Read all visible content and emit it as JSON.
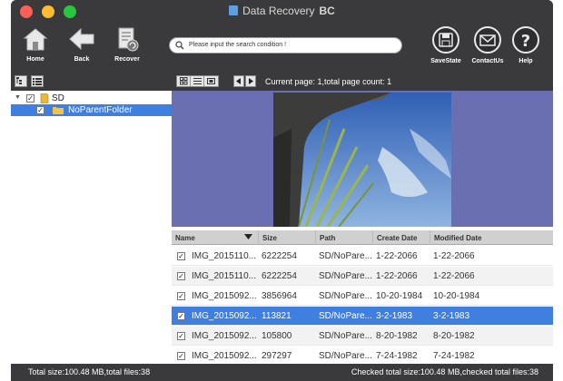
{
  "window": {
    "title": "Data Recovery",
    "title_suffix": "BC"
  },
  "toolbar": {
    "home_label": "Home",
    "back_label": "Back",
    "recover_label": "Recover",
    "savestate_label": "SaveState",
    "contactus_label": "ContactUs",
    "help_label": "Help",
    "search_placeholder": "Please input the search condition !"
  },
  "subbar": {
    "page_info": "Current page: 1,total page count: 1"
  },
  "tree": {
    "root_label": "SD",
    "child_label": "NoParentFolder"
  },
  "table": {
    "headers": {
      "name": "Name",
      "size": "Size",
      "path": "Path",
      "create": "Create Date",
      "modified": "Modified Date"
    },
    "rows": [
      {
        "name": "IMG_2015110...",
        "size": "6222254",
        "path": "SD/NoPare...",
        "create": "1-22-2066",
        "modified": "1-22-2066"
      },
      {
        "name": "IMG_2015110...",
        "size": "6222254",
        "path": "SD/NoPare...",
        "create": "1-22-2066",
        "modified": "1-22-2066"
      },
      {
        "name": "IMG_2015092...",
        "size": "3856964",
        "path": "SD/NoPare...",
        "create": "10-20-1984",
        "modified": "10-20-1984"
      },
      {
        "name": "IMG_2015092...",
        "size": "113821",
        "path": "SD/NoPare...",
        "create": "3-2-1983",
        "modified": "3-2-1983"
      },
      {
        "name": "IMG_2015092...",
        "size": "105800",
        "path": "SD/NoPare...",
        "create": "8-20-1982",
        "modified": "8-20-1982"
      },
      {
        "name": "IMG_2015092...",
        "size": "297297",
        "path": "SD/NoPare...",
        "create": "7-24-1982",
        "modified": "7-24-1982"
      }
    ]
  },
  "status": {
    "left": "Total size:100.48 MB,total files:38",
    "right": "Checked total size:100.48 MB,checked total files:38"
  },
  "colors": {
    "accent": "#3f7fe0",
    "chrome": "#3a3a3c",
    "preview_bg": "#6a6fb2"
  }
}
